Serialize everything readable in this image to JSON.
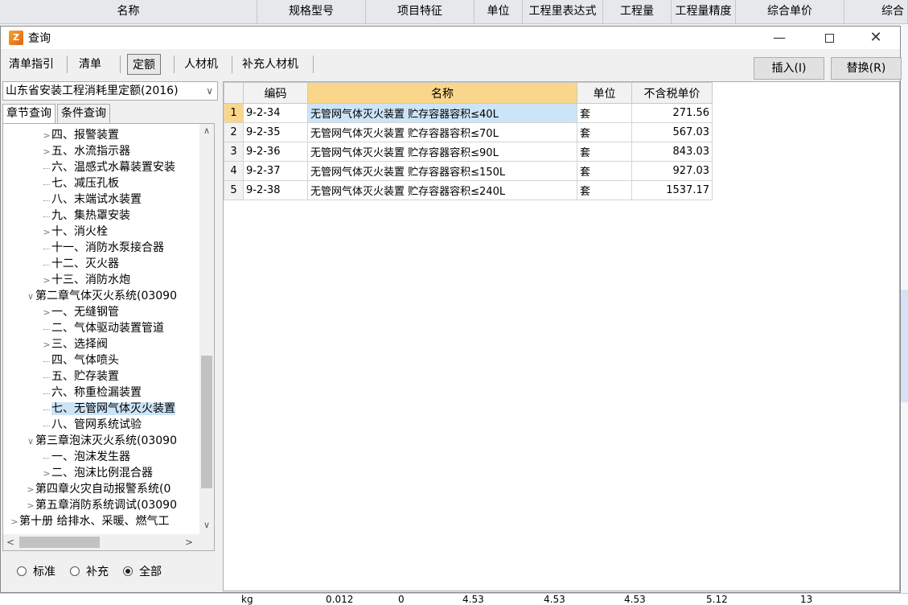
{
  "background": {
    "columns": [
      "名称",
      "规格型号",
      "项目特征",
      "单位",
      "工程里表达式",
      "工程量",
      "工程量精度",
      "综合单价",
      "综合"
    ],
    "bottom_row": [
      "kg",
      "0.012",
      "0",
      "4.53",
      "4.53",
      "4.53",
      "5.12",
      "13"
    ]
  },
  "dialog": {
    "icon_glyph": "Z",
    "title": "查询",
    "min_glyph": "—",
    "close_glyph": "✕"
  },
  "toolbar": {
    "tabs": [
      "清单指引",
      "清单",
      "定额",
      "人材机",
      "补充人材机"
    ],
    "insert_label": "插入(I)",
    "replace_label": "替换(R)"
  },
  "left": {
    "db_select": "山东省安装工程消耗里定额(2016)",
    "subtabs": [
      "章节查询",
      "条件查询"
    ],
    "tree": [
      {
        "text": "四、报警装置",
        "exp": ">",
        "indent": 3
      },
      {
        "text": "五、水流指示器",
        "exp": ">",
        "indent": 3
      },
      {
        "text": "六、温感式水幕装置安装",
        "exp": "",
        "indent": 3
      },
      {
        "text": "七、减压孔板",
        "exp": "",
        "indent": 3
      },
      {
        "text": "八、末端试水装置",
        "exp": "",
        "indent": 3
      },
      {
        "text": "九、集热罩安装",
        "exp": "",
        "indent": 3
      },
      {
        "text": "十、消火栓",
        "exp": ">",
        "indent": 3
      },
      {
        "text": "十一、消防水泵接合器",
        "exp": "",
        "indent": 3
      },
      {
        "text": "十二、灭火器",
        "exp": "",
        "indent": 3
      },
      {
        "text": "十三、消防水炮",
        "exp": ">",
        "indent": 3
      },
      {
        "text": "第二章气体灭火系统(03090",
        "exp": "v",
        "indent": 2
      },
      {
        "text": "一、无缝钢管",
        "exp": ">",
        "indent": 3
      },
      {
        "text": "二、气体驱动装置管道",
        "exp": "",
        "indent": 3
      },
      {
        "text": "三、选择阀",
        "exp": ">",
        "indent": 3
      },
      {
        "text": "四、气体喷头",
        "exp": "",
        "indent": 3
      },
      {
        "text": "五、贮存装置",
        "exp": "",
        "indent": 3
      },
      {
        "text": "六、称重检漏装置",
        "exp": "",
        "indent": 3
      },
      {
        "text": "七、无管网气体灭火装置",
        "exp": "",
        "indent": 3,
        "selected": true
      },
      {
        "text": "八、管网系统试验",
        "exp": "",
        "indent": 3
      },
      {
        "text": "第三章泡沫灭火系统(03090",
        "exp": "v",
        "indent": 2
      },
      {
        "text": "一、泡沫发生器",
        "exp": "",
        "indent": 3
      },
      {
        "text": "二、泡沫比例混合器",
        "exp": ">",
        "indent": 3
      },
      {
        "text": "第四章火灾自动报警系统(0",
        "exp": ">",
        "indent": 2
      },
      {
        "text": "第五章消防系统调试(03090",
        "exp": ">",
        "indent": 2
      },
      {
        "text": "第十册 给排水、采暖、燃气工",
        "exp": ">",
        "indent": 1
      }
    ],
    "radios": [
      {
        "label": "标准",
        "on": false
      },
      {
        "label": "补充",
        "on": false
      },
      {
        "label": "全部",
        "on": true
      }
    ]
  },
  "grid": {
    "headers": [
      "",
      "编码",
      "名称",
      "单位",
      "不含税单价"
    ],
    "rows": [
      {
        "rn": "1",
        "code": "9-2-34",
        "name": "无管网气体灭火装置 贮存容器容积≤40L",
        "unit": "套",
        "price": "271.56"
      },
      {
        "rn": "2",
        "code": "9-2-35",
        "name": "无管网气体灭火装置 贮存容器容积≤70L",
        "unit": "套",
        "price": "567.03"
      },
      {
        "rn": "3",
        "code": "9-2-36",
        "name": "无管网气体灭火装置 贮存容器容积≤90L",
        "unit": "套",
        "price": "843.03"
      },
      {
        "rn": "4",
        "code": "9-2-37",
        "name": "无管网气体灭火装置 贮存容器容积≤150L",
        "unit": "套",
        "price": "927.03"
      },
      {
        "rn": "5",
        "code": "9-2-38",
        "name": "无管网气体灭火装置 贮存容器容积≤240L",
        "unit": "套",
        "price": "1537.17"
      }
    ]
  }
}
